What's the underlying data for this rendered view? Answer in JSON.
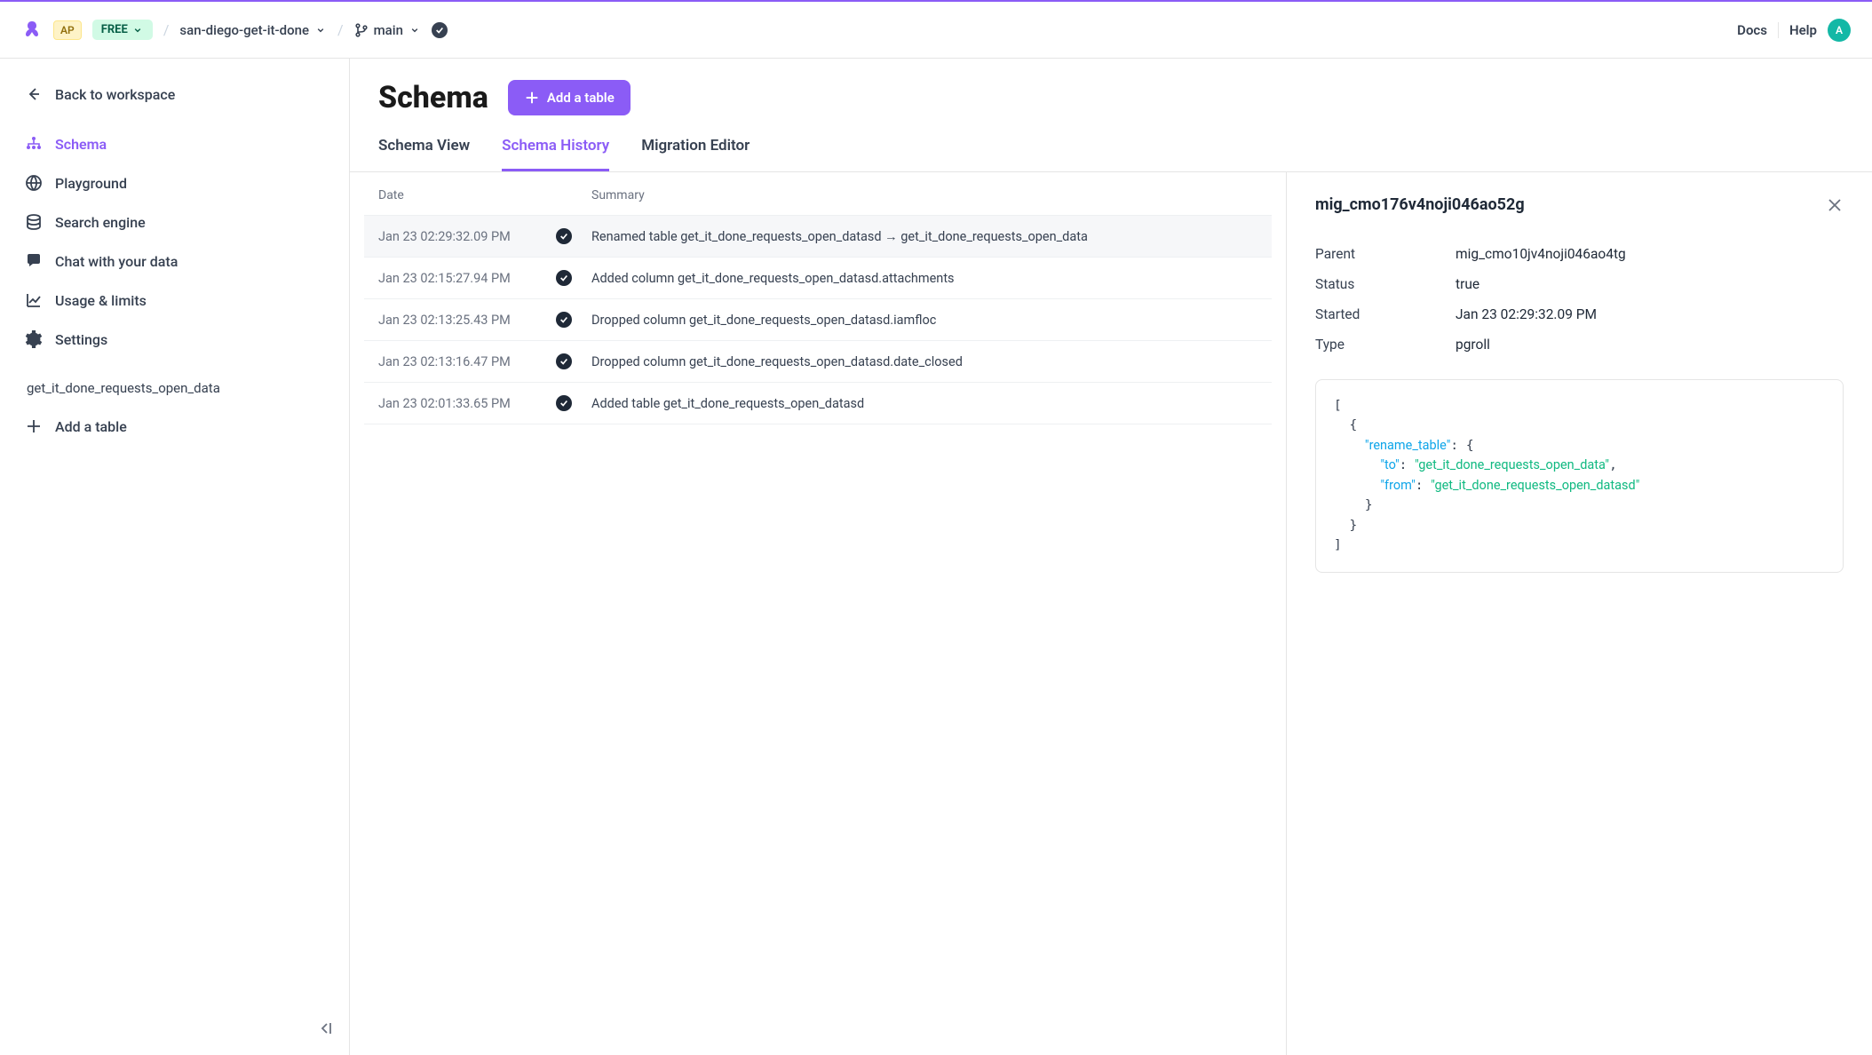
{
  "top": {
    "user_badge": "AP",
    "plan_badge": "FREE",
    "project": "san-diego-get-it-done",
    "branch": "main",
    "docs": "Docs",
    "help": "Help",
    "avatar": "A"
  },
  "sidebar": {
    "back": "Back to workspace",
    "items": [
      {
        "label": "Schema"
      },
      {
        "label": "Playground"
      },
      {
        "label": "Search engine"
      },
      {
        "label": "Chat with your data"
      },
      {
        "label": "Usage & limits"
      },
      {
        "label": "Settings"
      }
    ],
    "table": "get_it_done_requests_open_data",
    "add_table": "Add a table"
  },
  "page": {
    "title": "Schema",
    "add_button": "Add a table",
    "tabs": [
      {
        "label": "Schema View"
      },
      {
        "label": "Schema History"
      },
      {
        "label": "Migration Editor"
      }
    ]
  },
  "history": {
    "headers": {
      "date": "Date",
      "summary": "Summary"
    },
    "rows": [
      {
        "date": "Jan 23 02:29:32.09 PM",
        "summary": "Renamed table get_it_done_requests_open_datasd → get_it_done_requests_open_data"
      },
      {
        "date": "Jan 23 02:15:27.94 PM",
        "summary": "Added column get_it_done_requests_open_datasd.attachments"
      },
      {
        "date": "Jan 23 02:13:25.43 PM",
        "summary": "Dropped column get_it_done_requests_open_datasd.iamfloc"
      },
      {
        "date": "Jan 23 02:13:16.47 PM",
        "summary": "Dropped column get_it_done_requests_open_datasd.date_closed"
      },
      {
        "date": "Jan 23 02:01:33.65 PM",
        "summary": "Added table get_it_done_requests_open_datasd"
      }
    ]
  },
  "detail": {
    "title": "mig_cmo176v4noji046ao52g",
    "meta": [
      {
        "label": "Parent",
        "value": "mig_cmo10jv4noji046ao4tg"
      },
      {
        "label": "Status",
        "value": "true"
      },
      {
        "label": "Started",
        "value": "Jan 23 02:29:32.09 PM"
      },
      {
        "label": "Type",
        "value": "pgroll"
      }
    ],
    "json": {
      "rename_table_key": "\"rename_table\"",
      "to_key": "\"to\"",
      "to_val": "\"get_it_done_requests_open_data\"",
      "from_key": "\"from\"",
      "from_val": "\"get_it_done_requests_open_datasd\""
    }
  }
}
